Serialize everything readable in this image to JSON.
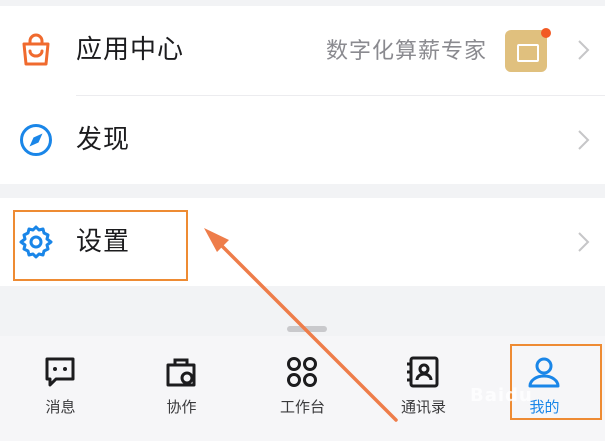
{
  "menu": {
    "items": [
      {
        "label": "应用中心",
        "subtitle": "数字化算薪专家"
      },
      {
        "label": "发现"
      },
      {
        "label": "设置"
      }
    ]
  },
  "tabbar": {
    "tabs": [
      {
        "label": "消息",
        "icon": "message-icon"
      },
      {
        "label": "协作",
        "icon": "collaboration-icon"
      },
      {
        "label": "工作台",
        "icon": "workbench-icon"
      },
      {
        "label": "通讯录",
        "icon": "contacts-icon"
      },
      {
        "label": "我的",
        "icon": "person-icon",
        "active": true
      }
    ]
  },
  "watermark": "Baidu",
  "colors": {
    "accent_blue": "#1a86e8",
    "app_center_icon": "#f06a2e",
    "annotation_orange": "#ee8b33",
    "badge_red": "#f25a24",
    "badge_gold": "#e0c07e"
  }
}
